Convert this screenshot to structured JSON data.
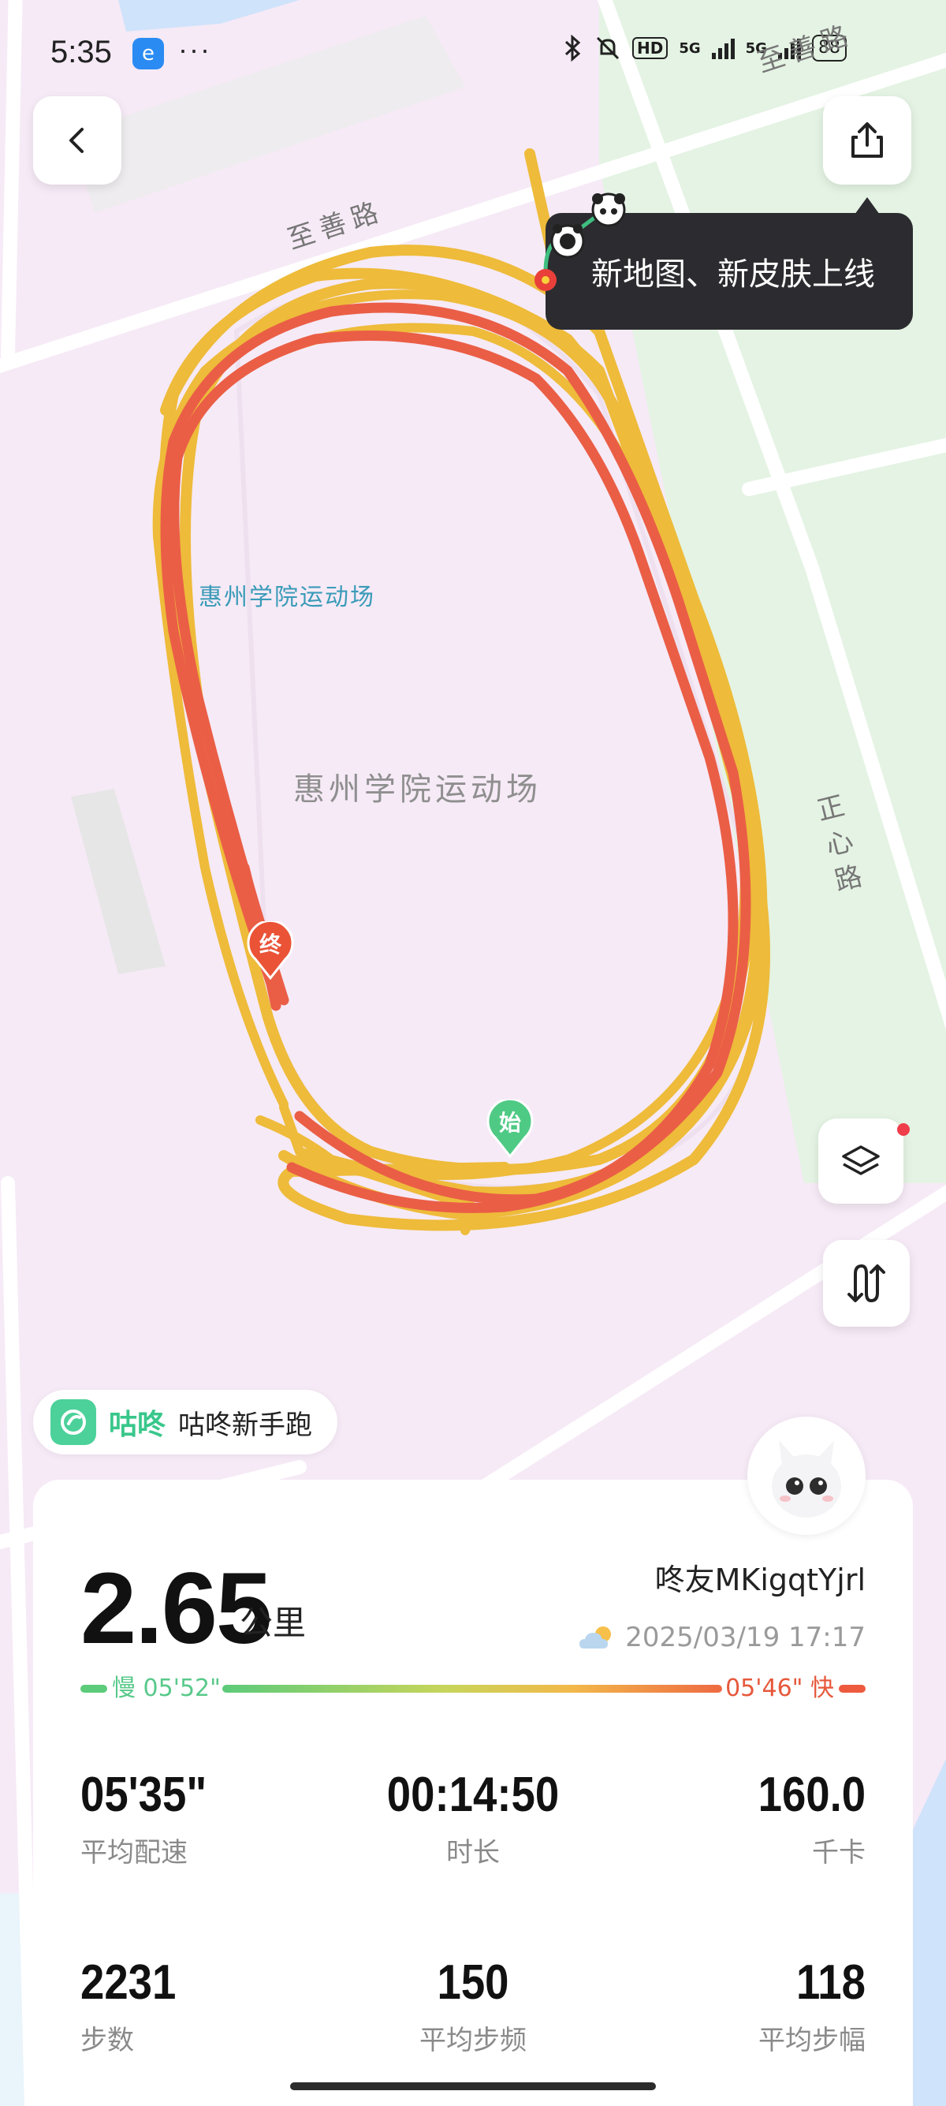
{
  "status_bar": {
    "time": "5:35",
    "app_icon_glyph": "e",
    "more": "···",
    "hd": "HD",
    "net1": "5G",
    "net2": "5G",
    "battery": "88"
  },
  "map": {
    "venue_label_small": "惠州学院运动场",
    "venue_label_large": "惠州学院运动场",
    "road_top": "至善路",
    "road_top_right": "至善路",
    "road_right": "正心路",
    "start_marker": "始",
    "end_marker": "终"
  },
  "tooltip": {
    "text": "新地图、新皮肤上线"
  },
  "brand_pill": {
    "brand": "咕咚",
    "label": "咕咚新手跑"
  },
  "summary": {
    "distance": "2.65",
    "distance_unit": "公里",
    "username": "咚友MKigqtYjrl",
    "datetime": "2025/03/19 17:17",
    "weather_icon": "partly-cloudy-icon",
    "pace_slow": "慢 05'52\"",
    "pace_fast": "05'46\" 快",
    "stats": [
      {
        "value": "05'35\"",
        "label": "平均配速"
      },
      {
        "value": "00:14:50",
        "label": "时长"
      },
      {
        "value": "160.0",
        "label": "千卡"
      },
      {
        "value": "2231",
        "label": "步数"
      },
      {
        "value": "150",
        "label": "平均步频"
      },
      {
        "value": "118",
        "label": "平均步幅"
      }
    ]
  },
  "colors": {
    "route_orange": "#eebb3a",
    "route_red": "#ea5e46",
    "start_green": "#4fca85",
    "end_red": "#ea5336",
    "map_pink": "#f6eaf6",
    "map_green": "#e4f3e3"
  }
}
